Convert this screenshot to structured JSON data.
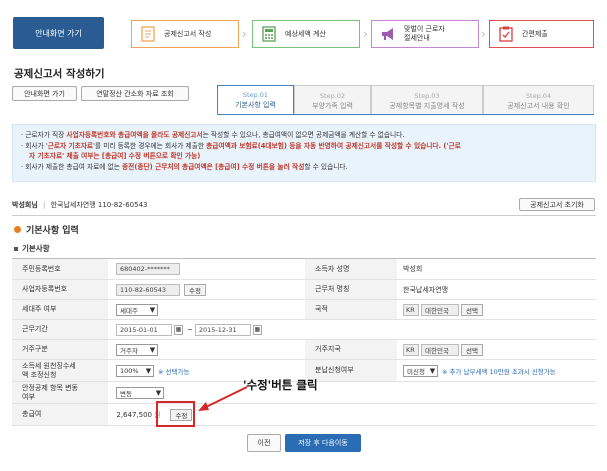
{
  "topnav": {
    "home_label": "안내화면 가기",
    "steps": [
      {
        "label": "공제신고서 작성",
        "icon": "document-edit-icon"
      },
      {
        "label": "예상세액 계산",
        "icon": "calculator-icon"
      },
      {
        "label_line1": "맞벌이 근로자",
        "label_line2": "절세안내",
        "icon": "megaphone-icon"
      },
      {
        "label": "간편제출",
        "icon": "clipboard-submit-icon"
      }
    ]
  },
  "page_title": "공제신고서 작성하기",
  "tool_buttons": {
    "home": "안내화면 가기",
    "guide": "연말정산 간소화 자료 조회"
  },
  "tabs": [
    {
      "step": "Step.01",
      "label": "기본사항 입력"
    },
    {
      "step": "Step.02",
      "label": "부양가족 입력"
    },
    {
      "step": "Step.03",
      "label": "공제항목별 지출명세 작성"
    },
    {
      "step": "Step.04",
      "label": "공제신고서 내용 확인"
    }
  ],
  "notice": {
    "line1_a": "· 근로자가 직장 ",
    "line1_b": "사업자등록번호와 총급여액을 몰라도 공제신고서",
    "line1_c": "는 작성할 수 있으나, 총급여액이 없으면 공제금액을 계산할 수 없습니다.",
    "line2_a": "· 회사가 '",
    "line2_b": "근로자 기초자료",
    "line2_c": "'를 미리 등록한 경우에는 회사가 제출한 ",
    "line2_d": "총급여액과 보험료(4대보험) 등을 자동 반영하여 공제신고서를 작성할 수 있습니다. ('근로",
    "line3": "자 기초자료' 제출 여부는 [총급여] 수정 버튼으로 확인 가능)",
    "line4_a": "· 회사가 제출한 총급여 자료에 없는 ",
    "line4_b": "종전(종단) 근무처의 총급여액은 [총급여] 수정 버튼을 눌러 작성",
    "line4_c": "할 수 있습니다."
  },
  "biz_line": {
    "name": "박성희님",
    "sep": "|",
    "text": "한국납세자연맹 110-82-60543"
  },
  "reset_button": "공제신고서 초기화",
  "section_title": "기본사항 입력",
  "subsection_title": "기본사항",
  "form": {
    "resident_no_label": "주민등록번호",
    "resident_no_value": "680402-*******",
    "employee_name_label": "소득자 성명",
    "employee_name_value": "박성희",
    "biz_no_label": "사업자등록번호",
    "biz_no_value": "110-82-60543",
    "biz_no_edit": "수정",
    "company_label": "근무처 명칭",
    "company_value": "한국납세자연맹",
    "householder_label": "세대주 여부",
    "householder_value": "세대주",
    "nationality_label": "국적",
    "nationality_code": "KR",
    "nationality_name": "대한민국",
    "nationality_btn": "선택",
    "period_label": "근무기간",
    "period_start": "2015-01-01",
    "period_tilde": "~",
    "period_end": "2015-12-31",
    "residence_label": "거주구분",
    "residence_value": "거주자",
    "residence_country_label": "거주지국",
    "residence_country_code": "KR",
    "residence_country_name": "대한민국",
    "residence_country_btn": "선택",
    "withholding_label_1": "소득세 원천징수세",
    "withholding_label_2": "액 조정신청",
    "withholding_value": "100%",
    "withholding_note": "※ 선택가능",
    "installment_label": "분납신청여부",
    "installment_value": "미신청",
    "installment_note": "※ 추가 납부세액 10만원 초과시 신청가능",
    "health_label_1": "안정공제 항목 변동",
    "health_label_2": "여부",
    "health_value": "변동",
    "total_pay_label": "총급여",
    "total_pay_value": "2,647,500",
    "total_pay_unit": "원",
    "total_pay_edit": "수정"
  },
  "annotation": "'수정'버튼 클릭",
  "bottom": {
    "prev": "이전",
    "next": "저장 후 다음이동"
  },
  "colors": {
    "primary": "#2a5c93",
    "accent_orange": "#e67e22",
    "annotation_red": "#d62828",
    "notice_bg": "#e9f3fb"
  }
}
